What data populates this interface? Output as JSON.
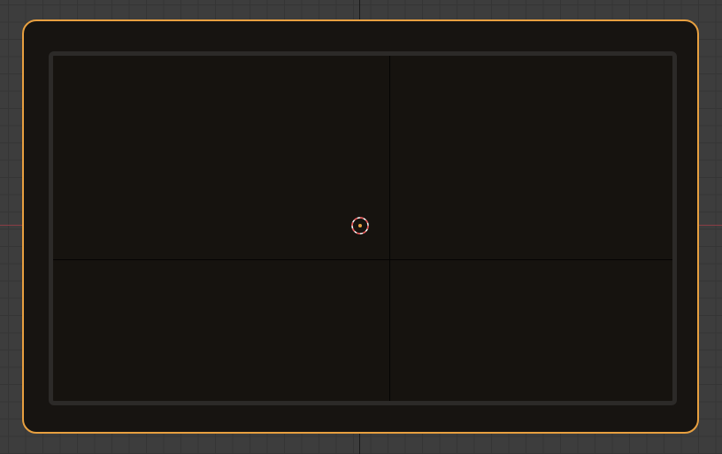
{
  "viewport": {
    "background_color": "#3d3d3d",
    "grid_color": "#353535",
    "x_axis_color": "#8a3d45"
  },
  "object": {
    "name": "plane",
    "selected": true,
    "outline_color": "#e8a040",
    "fill_color": "#171411"
  },
  "cursor_3d": {
    "icon": "3d-cursor-icon",
    "ring_colors": [
      "#e85050",
      "#ffffff"
    ]
  }
}
